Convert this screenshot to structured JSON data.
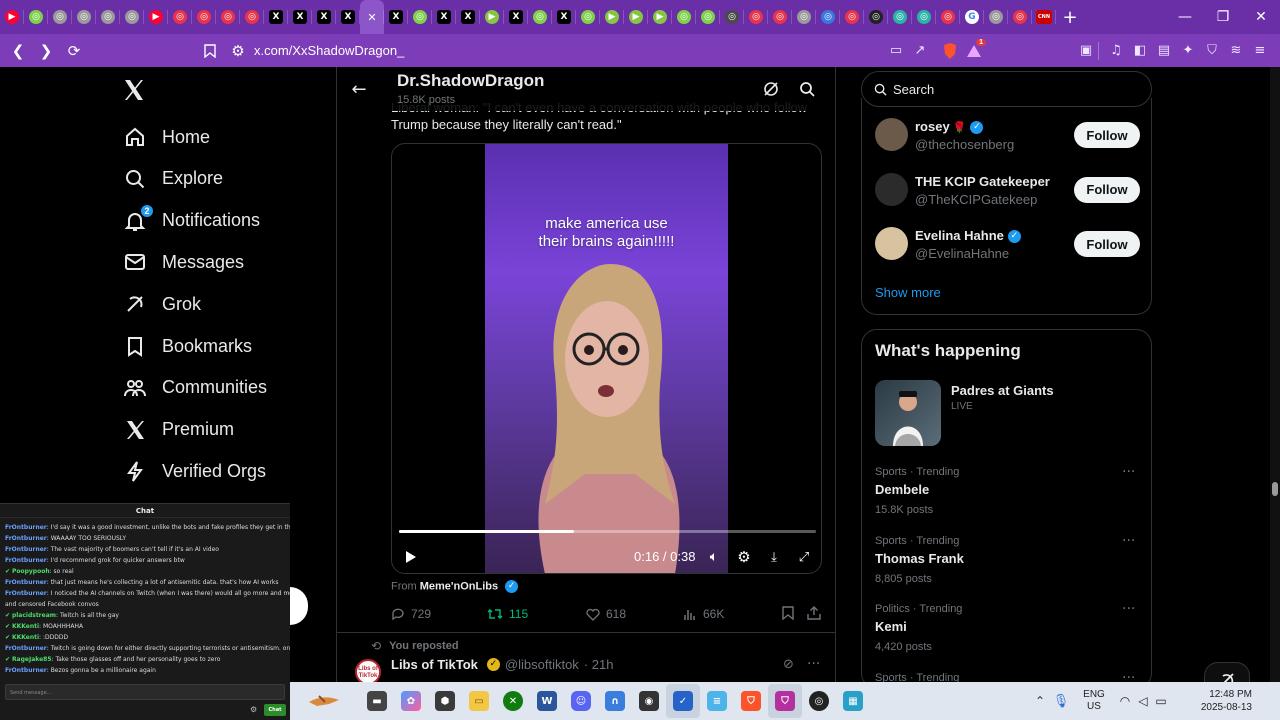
{
  "browser": {
    "url": "x.com/XxShadowDragon_",
    "tabs": [
      {
        "icon": "youtube-icon",
        "color": "#ff0033",
        "glyph": "▶"
      },
      {
        "icon": "tab-icon",
        "color": "#7fd14a",
        "glyph": "◎"
      },
      {
        "icon": "tab-icon",
        "color": "#9a9a9a",
        "glyph": "◎"
      },
      {
        "icon": "tab-icon",
        "color": "#9a9a9a",
        "glyph": "◎"
      },
      {
        "icon": "tab-icon",
        "color": "#9a9a9a",
        "glyph": "◎"
      },
      {
        "icon": "tab-icon",
        "color": "#9a9a9a",
        "glyph": "◎"
      },
      {
        "icon": "youtube-icon",
        "color": "#ff0033",
        "glyph": "▶"
      },
      {
        "icon": "tab-icon",
        "color": "#e8334a",
        "glyph": "◎"
      },
      {
        "icon": "tab-icon",
        "color": "#e8334a",
        "glyph": "◎"
      },
      {
        "icon": "tab-icon",
        "color": "#e8334a",
        "glyph": "◎"
      },
      {
        "icon": "tab-icon",
        "color": "#e8334a",
        "glyph": "◎"
      },
      {
        "icon": "x-icon",
        "color": "#000000",
        "glyph": "X"
      },
      {
        "icon": "x-icon",
        "color": "#000000",
        "glyph": "X"
      },
      {
        "icon": "x-icon",
        "color": "#000000",
        "glyph": "X"
      },
      {
        "icon": "x-icon",
        "color": "#000000",
        "glyph": "X"
      },
      {
        "icon": "close-icon",
        "color": "#8c55c8",
        "glyph": "✕",
        "active": true
      },
      {
        "icon": "x-icon",
        "color": "#000000",
        "glyph": "X"
      },
      {
        "icon": "tab-icon",
        "color": "#7fd14a",
        "glyph": "◎"
      },
      {
        "icon": "x-icon",
        "color": "#000000",
        "glyph": "X"
      },
      {
        "icon": "x-icon",
        "color": "#000000",
        "glyph": "X"
      },
      {
        "icon": "rumble-icon",
        "color": "#85c742",
        "glyph": "▶"
      },
      {
        "icon": "x-icon",
        "color": "#000000",
        "glyph": "X"
      },
      {
        "icon": "tab-icon",
        "color": "#7fd14a",
        "glyph": "◎"
      },
      {
        "icon": "x-icon",
        "color": "#000000",
        "glyph": "X"
      },
      {
        "icon": "tab-icon",
        "color": "#7fd14a",
        "glyph": "◎"
      },
      {
        "icon": "rumble-icon",
        "color": "#85c742",
        "glyph": "▶"
      },
      {
        "icon": "rumble-icon",
        "color": "#85c742",
        "glyph": "▶"
      },
      {
        "icon": "rumble-icon",
        "color": "#85c742",
        "glyph": "▶"
      },
      {
        "icon": "tab-icon",
        "color": "#7fd14a",
        "glyph": "◎"
      },
      {
        "icon": "tab-icon",
        "color": "#7fd14a",
        "glyph": "◎"
      },
      {
        "icon": "tab-icon",
        "color": "#4a4a4a",
        "glyph": "◎"
      },
      {
        "icon": "tab-icon",
        "color": "#e8334a",
        "glyph": "◎"
      },
      {
        "icon": "tab-icon",
        "color": "#e8334a",
        "glyph": "◎"
      },
      {
        "icon": "tab-icon",
        "color": "#9a9a9a",
        "glyph": "◎"
      },
      {
        "icon": "tab-icon",
        "color": "#3a78e0",
        "glyph": "◎"
      },
      {
        "icon": "tab-icon",
        "color": "#e8334a",
        "glyph": "◎"
      },
      {
        "icon": "tab-icon",
        "color": "#222222",
        "glyph": "◎"
      },
      {
        "icon": "tab-icon",
        "color": "#2bb3a8",
        "glyph": "◎"
      },
      {
        "icon": "tab-icon",
        "color": "#2bb3a8",
        "glyph": "◎"
      },
      {
        "icon": "tab-icon",
        "color": "#e8334a",
        "glyph": "◎"
      },
      {
        "icon": "google-icon",
        "color": "#ffffff",
        "glyph": "G"
      },
      {
        "icon": "tab-icon",
        "color": "#9a9a9a",
        "glyph": "◎"
      },
      {
        "icon": "tab-icon",
        "color": "#e8334a",
        "glyph": "◎"
      },
      {
        "icon": "cnn-icon",
        "color": "#cc0000",
        "glyph": "CNN"
      }
    ],
    "brave_badge": "1"
  },
  "nav": {
    "items": [
      {
        "name": "home",
        "label": "Home",
        "icon": "home-icon"
      },
      {
        "name": "explore",
        "label": "Explore",
        "icon": "search-icon"
      },
      {
        "name": "notifications",
        "label": "Notifications",
        "icon": "bell-icon",
        "badge": "2"
      },
      {
        "name": "messages",
        "label": "Messages",
        "icon": "mail-icon"
      },
      {
        "name": "grok",
        "label": "Grok",
        "icon": "grok-icon"
      },
      {
        "name": "bookmarks",
        "label": "Bookmarks",
        "icon": "bookmark-icon"
      },
      {
        "name": "communities",
        "label": "Communities",
        "icon": "people-icon"
      },
      {
        "name": "premium",
        "label": "Premium",
        "icon": "x-icon"
      },
      {
        "name": "verified-orgs",
        "label": "Verified Orgs",
        "icon": "lightning-icon"
      }
    ]
  },
  "profile_header": {
    "name": "Dr.ShadowDragon",
    "posts": "15.8K posts"
  },
  "tweet": {
    "text_line1": "Liberal woman: \"I can't even have a conversation with people who follow",
    "text_line2": "Trump because they literally can't read.\"",
    "video_caption_line1": "make america use",
    "video_caption_line2": "their brains again!!!!!",
    "time": "0:16 / 0:38",
    "progress": 0.42,
    "from_prefix": "From",
    "from_user": "Meme'nOnLibs",
    "replies": "729",
    "reposts": "115",
    "likes": "618",
    "views": "66K"
  },
  "next_post": {
    "reposted_label": "You reposted",
    "name": "Libs of TikTok",
    "handle": "@libsoftiktok",
    "time": "· 21h"
  },
  "search": {
    "placeholder": "Search"
  },
  "who_to_follow": {
    "users": [
      {
        "name": "rosey",
        "handle": "@thechosenberg",
        "emoji": "🌹",
        "verified": true,
        "button": "Follow"
      },
      {
        "name": "THE KCIP Gatekeeper",
        "handle": "@TheKCIPGatekeep",
        "emoji": "",
        "verified": false,
        "button": "Follow"
      },
      {
        "name": "Evelina Hahne",
        "handle": "@EvelinaHahne",
        "emoji": "",
        "verified": true,
        "button": "Follow"
      }
    ],
    "show_more": "Show more"
  },
  "happening": {
    "title": "What's happening",
    "event": {
      "name": "Padres at Giants",
      "status": "LIVE"
    },
    "trends": [
      {
        "category": "Sports · Trending",
        "name": "Dembele",
        "count": "15.8K posts"
      },
      {
        "category": "Sports · Trending",
        "name": "Thomas Frank",
        "count": "8,805 posts"
      },
      {
        "category": "Politics · Trending",
        "name": "Kemi",
        "count": "4,420 posts"
      },
      {
        "category": "Sports · Trending",
        "name": "",
        "count": ""
      }
    ]
  },
  "chat": {
    "title": "Chat",
    "messages": [
      {
        "user": "FrOntburner",
        "green": false,
        "text": "I'd say it was a good investment, unlike the bots and fake profiles they get in their feed"
      },
      {
        "user": "FrOntburner",
        "green": false,
        "text": "WAAAAY TOO SERIOUSLY"
      },
      {
        "user": "FrOntburner",
        "green": false,
        "text": "The vast majority of boomers can't tell if it's an AI video"
      },
      {
        "user": "FrOntburner",
        "green": false,
        "text": "I'd recommend grok for quicker answers btw"
      },
      {
        "user": "Poopypooh",
        "green": true,
        "text": "so real"
      },
      {
        "user": "FrOntburner",
        "green": false,
        "text": "that just means he's collecting a lot of antisemitic data. that's how AI works"
      },
      {
        "user": "FrOntburner",
        "green": false,
        "text": "I noticed the AI channels on Twitch (when I was there) would all go more and more woke. like tumblr"
      },
      {
        "user": "",
        "green": false,
        "text": "and censored Facebook convos"
      },
      {
        "user": "placidstream",
        "green": true,
        "text": "Twitch is all the gay"
      },
      {
        "user": "KKKenti",
        "green": true,
        "text": "MOAHHHAHA"
      },
      {
        "user": "KKKenti",
        "green": true,
        "text": ":DDDDD"
      },
      {
        "user": "FrOntburner",
        "green": false,
        "text": "Twitch is going down for either directly supporting terrorists or antisemitism. one or the other."
      },
      {
        "user": "RageJake85",
        "green": true,
        "text": "Take those glasses off and her personality goes to zero"
      },
      {
        "user": "FrOntburner",
        "green": false,
        "text": "Bezos gonna be a millionaire again"
      }
    ],
    "input_placeholder": "Send message...",
    "send_label": "Chat"
  },
  "taskbar": {
    "lang": "ENG",
    "region": "US",
    "time": "12:48 PM",
    "date": "2025-08-13"
  }
}
